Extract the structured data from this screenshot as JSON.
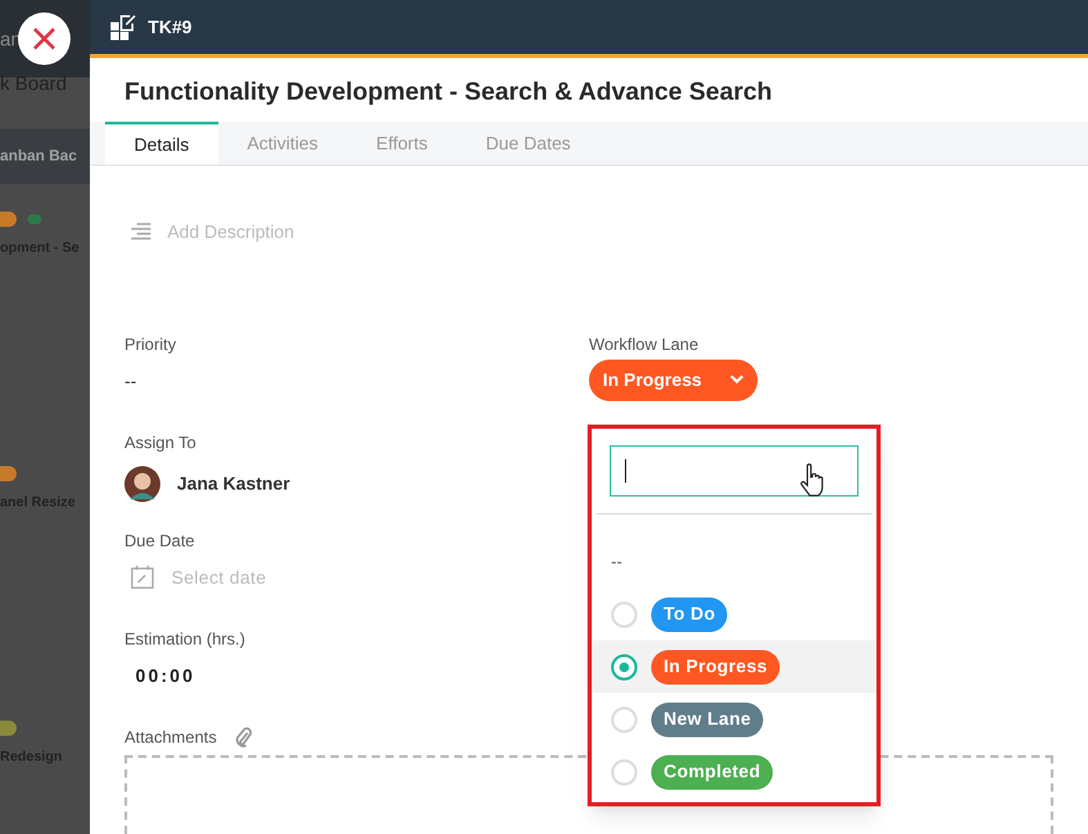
{
  "background": {
    "header_text": "an",
    "board_title": "k Board",
    "section_title": "anban Bac",
    "cards": [
      {
        "title": "opment - Se",
        "color": "#c77a2a",
        "extra_icon": true
      },
      {
        "title": "anel Resize",
        "color": "#c77a2a",
        "extra_icon": false
      },
      {
        "title": "Redesign",
        "color": "#8a8a3a",
        "extra_icon": false
      }
    ]
  },
  "panel": {
    "task_id": "TK#9",
    "title": "Functionality Development - Search & Advance Search",
    "tabs": [
      {
        "label": "Details",
        "selected": true
      },
      {
        "label": "Activities",
        "selected": false
      },
      {
        "label": "Efforts",
        "selected": false
      },
      {
        "label": "Due Dates",
        "selected": false
      }
    ],
    "description": {
      "placeholder": "Add Description"
    },
    "fields": [
      {
        "kind": "text",
        "label": "Priority",
        "value": "--"
      },
      {
        "kind": "user",
        "label": "Assign To",
        "value": "Jana Kastner"
      },
      {
        "kind": "date",
        "label": "Due Date",
        "placeholder": "Select date"
      },
      {
        "kind": "time",
        "label": "Estimation (hrs.)",
        "value": "00:00"
      },
      {
        "kind": "attach",
        "label": "Attachments"
      }
    ],
    "workflow": {
      "label": "Workflow Lane",
      "value": "In Progress",
      "color": "#ff5722"
    },
    "dropdown": {
      "options": [
        {
          "kind": "none",
          "label": "--",
          "selected": false
        },
        {
          "kind": "lane",
          "label": "To Do",
          "color": "#2196f3",
          "selected": false
        },
        {
          "kind": "lane",
          "label": "In Progress",
          "color": "#ff5722",
          "selected": true
        },
        {
          "kind": "lane",
          "label": "New Lane",
          "color": "#607d8b",
          "selected": false
        },
        {
          "kind": "lane",
          "label": "Completed",
          "color": "#4caf50",
          "selected": false
        }
      ]
    }
  }
}
